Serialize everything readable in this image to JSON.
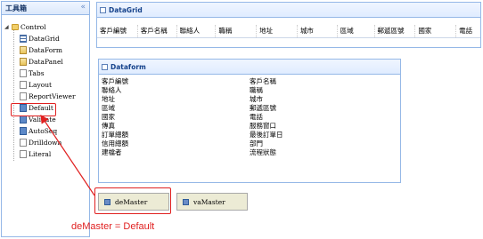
{
  "toolbox": {
    "title": "工具箱",
    "collapse_glyph": "«",
    "root": "Control",
    "items": [
      "DataGrid",
      "DataForm",
      "DataPanel",
      "Tabs",
      "Layout",
      "ReportViewer",
      "Default",
      "Validate",
      "AutoSeq",
      "Drilldown",
      "Literal"
    ]
  },
  "datagrid": {
    "title": "DataGrid",
    "columns": [
      "客戶編號",
      "客戶名稱",
      "聯絡人",
      "職稱",
      "地址",
      "城市",
      "區域",
      "郵遞區號",
      "國家",
      "電話"
    ]
  },
  "dataform": {
    "title": "Dataform",
    "left": [
      "客戶編號",
      "聯絡人",
      "地址",
      "區域",
      "國家",
      "傳真",
      "訂單總額",
      "信用總額",
      "建檔者"
    ],
    "right": [
      "客戶名稱",
      "職稱",
      "城市",
      "郵遞區號",
      "電話",
      "服務窗口",
      "最後訂單日",
      "部門",
      "流程狀態"
    ]
  },
  "tabs": [
    "deMaster",
    "vaMaster"
  ],
  "annotation": "deMaster = Default",
  "colors": {
    "accent_border": "#95b8e7",
    "annotation": "#e02020"
  }
}
